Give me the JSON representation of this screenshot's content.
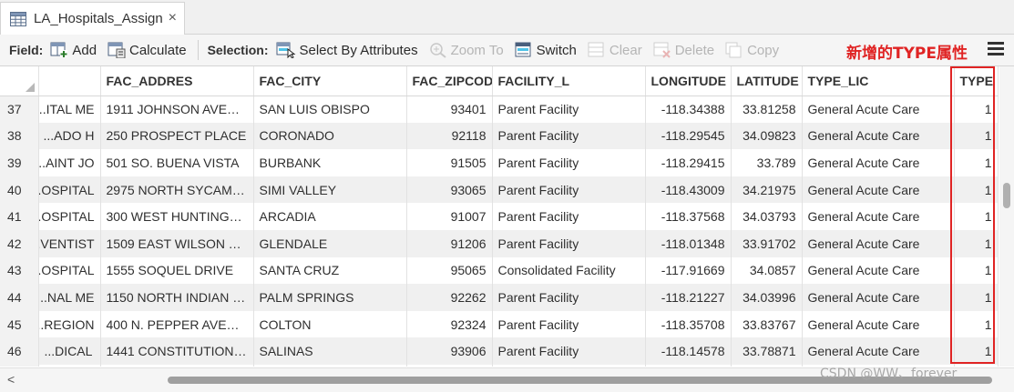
{
  "tab": {
    "title": "LA_Hospitals_Assign",
    "close_glyph": "×",
    "icon": "table-icon"
  },
  "toolbar": {
    "field_label": "Field:",
    "add_label": "Add",
    "calculate_label": "Calculate",
    "selection_label": "Selection:",
    "select_by_attributes_label": "Select By Attributes",
    "zoom_to_label": "Zoom To",
    "switch_label": "Switch",
    "clear_label": "Clear",
    "delete_label": "Delete",
    "copy_label": "Copy"
  },
  "annotation": {
    "text": "新增的TYPE属性",
    "color": "#e02424"
  },
  "table": {
    "columns": [
      "",
      "",
      "FAC_ADDRES",
      "FAC_CITY",
      "FAC_ZIPCOD",
      "FACILITY_L",
      "LONGITUDE",
      "LATITUDE",
      "TYPE_LIC",
      "TYPE"
    ],
    "rows": [
      [
        "37",
        "ITAL ME...",
        "1911 JOHNSON AVENUE",
        "SAN LUIS OBISPO",
        "93401",
        "Parent Facility",
        "-118.34388",
        "33.81258",
        "General Acute Care",
        "1"
      ],
      [
        "38",
        "ADO H...",
        "250 PROSPECT PLACE",
        "CORONADO",
        "92118",
        "Parent Facility",
        "-118.29545",
        "34.09823",
        "General Acute Care",
        "1"
      ],
      [
        "39",
        "AINT JO...",
        "501 SO. BUENA VISTA",
        "BURBANK",
        "91505",
        "Parent Facility",
        "-118.29415",
        "33.789",
        "General Acute Care",
        "1"
      ],
      [
        "40",
        "OSPITAL...",
        "2975 NORTH SYCAMO...",
        "SIMI VALLEY",
        "93065",
        "Parent Facility",
        "-118.43009",
        "34.21975",
        "General Acute Care",
        "1"
      ],
      [
        "41",
        "OSPITAL...",
        "300 WEST HUNTINGTO...",
        "ARCADIA",
        "91007",
        "Parent Facility",
        "-118.37568",
        "34.03793",
        "General Acute Care",
        "1"
      ],
      [
        "42",
        "VENTIST...",
        "1509 EAST WILSON TE...",
        "GLENDALE",
        "91206",
        "Parent Facility",
        "-118.01348",
        "33.91702",
        "General Acute Care",
        "1"
      ],
      [
        "43",
        "OSPITAL...",
        "1555 SOQUEL DRIVE",
        "SANTA CRUZ",
        "95065",
        "Consolidated Facility",
        "-117.91669",
        "34.0857",
        "General Acute Care",
        "1"
      ],
      [
        "44",
        "NAL ME...",
        "1150 NORTH INDIAN C...",
        "PALM SPRINGS",
        "92262",
        "Parent Facility",
        "-118.21227",
        "34.03996",
        "General Acute Care",
        "1"
      ],
      [
        "45",
        "REGION...",
        "400 N. PEPPER AVENUE",
        "COLTON",
        "92324",
        "Parent Facility",
        "-118.35708",
        "33.83767",
        "General Acute Care",
        "1"
      ],
      [
        "46",
        "DICAL...",
        "1441 CONSTITUTION B...",
        "SALINAS",
        "93906",
        "Parent Facility",
        "-118.14578",
        "33.78871",
        "General Acute Care",
        "1"
      ],
      [
        "",
        "",
        "",
        "",
        "",
        "",
        "",
        "",
        "",
        ""
      ]
    ]
  },
  "scrollbar": {
    "left_arrow": "<"
  },
  "watermark": "CSDN @WW、forever"
}
